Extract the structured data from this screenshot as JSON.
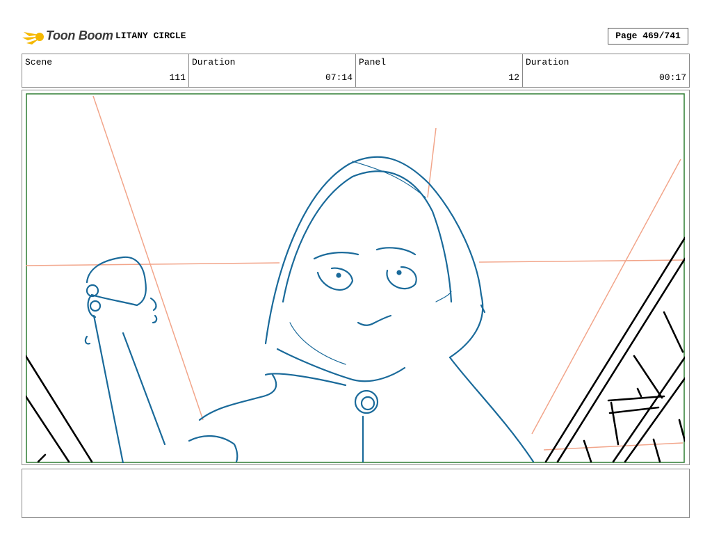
{
  "header": {
    "logo_text": "Toon Boom",
    "project_title": "LITANY CIRCLE",
    "page_label": "Page 469/741"
  },
  "info": {
    "scene_label": "Scene",
    "scene_value": "111",
    "scene_duration_label": "Duration",
    "scene_duration_value": "07:14",
    "panel_label": "Panel",
    "panel_value": "12",
    "panel_duration_label": "Duration",
    "panel_duration_value": "00:17"
  },
  "panel": {
    "image_description": "Rough storyboard sketch: hooded figure with raised fist behind diagonal bars",
    "colors": {
      "frame": "#2e7d32",
      "sketch": "#1a6a9a",
      "guides": "#f2a58a",
      "foreground": "#000000"
    }
  },
  "notes": {
    "text": ""
  }
}
